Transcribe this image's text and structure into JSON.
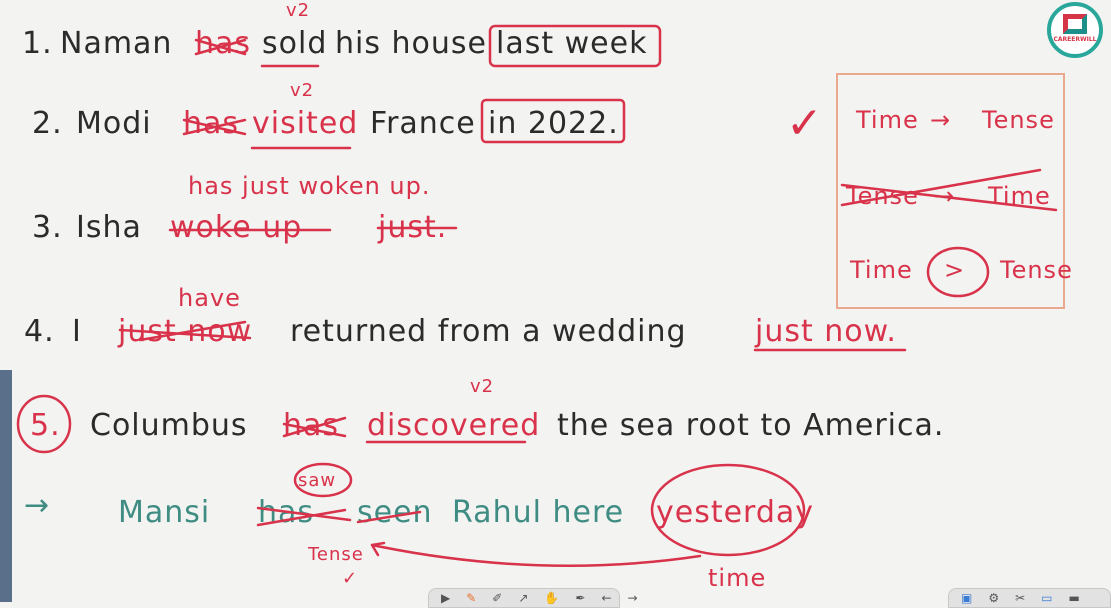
{
  "logo": {
    "text": "CAREERWILL"
  },
  "colors": {
    "ink": "#2b2b2b",
    "red": "#d8334a",
    "teal": "#3f8c83"
  },
  "lines": [
    {
      "num": "1.",
      "words": [
        "Naman",
        "has",
        "sold",
        "his house",
        "last week"
      ],
      "mark": "v2"
    },
    {
      "num": "2.",
      "words": [
        "Modi",
        "has",
        "visited",
        "France",
        "in 2022."
      ],
      "mark": "v2"
    },
    {
      "num": "3.",
      "words": [
        "Isha",
        "woke up",
        "just."
      ],
      "correction": "has just woken up."
    },
    {
      "num": "4.",
      "words": [
        "I",
        "just now",
        "returned from a wedding",
        "just now."
      ],
      "correction": "have"
    },
    {
      "num": "5.",
      "words": [
        "Columbus",
        "has",
        "discovered",
        "the sea root to America."
      ],
      "mark": "v2"
    },
    {
      "num": "→",
      "words": [
        "Mansi",
        "has",
        "seen",
        "Rahul here",
        "yesterday"
      ],
      "correction": "saw",
      "note1": "Tense",
      "note2": "time",
      "tick": "✓"
    }
  ],
  "box": {
    "row1": [
      "Time",
      "→",
      "Tense"
    ],
    "row2": [
      "Tense",
      "→",
      "Time"
    ],
    "row3": [
      "Time",
      ">",
      "Tense"
    ],
    "tick": "✓"
  },
  "toolbar": {
    "left": [
      "▶",
      "✎",
      "✐",
      "↗",
      "✋",
      "✒",
      "←",
      "→"
    ],
    "right": [
      "▣",
      "⚙",
      "✂",
      "▭",
      "▬"
    ]
  }
}
